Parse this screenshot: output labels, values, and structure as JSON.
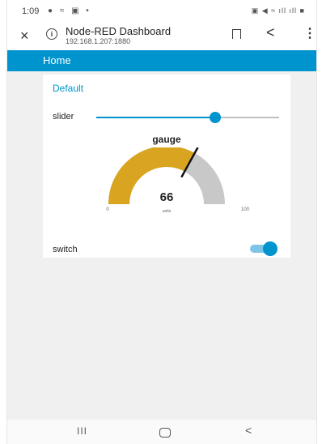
{
  "status_bar": {
    "time": "1:09",
    "left_icons": "● ≈ ▣ •",
    "right_icons": "▣ ◀ ≈ ıll ıll ■"
  },
  "browser": {
    "title": "Node-RED Dashboard",
    "url": "192.168.1.207:1880",
    "close_icon": "×",
    "info_icon": "i",
    "share_icon": "<",
    "menu_icon": "⋮"
  },
  "header": {
    "title": "Home"
  },
  "group": {
    "title": "Default"
  },
  "slider": {
    "label": "slider",
    "value_fraction": 0.65
  },
  "gauge": {
    "title": "gauge",
    "value": 66,
    "min": 0,
    "max": 100,
    "units": "units",
    "colors": {
      "fill": "#d9a520",
      "track": "#c8c8c8",
      "needle": "#111111"
    }
  },
  "switch": {
    "label": "switch",
    "state": "on"
  },
  "navbar": {
    "recent": "III",
    "back": "<"
  },
  "colors": {
    "accent": "#0094ce",
    "background": "#f0f0f0"
  }
}
